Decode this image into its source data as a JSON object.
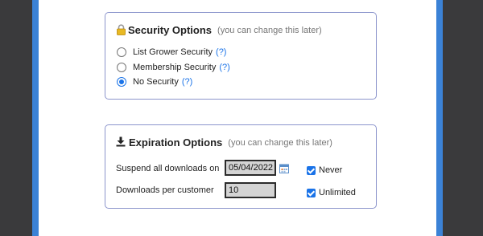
{
  "security": {
    "title": "Security Options",
    "note": "(you can change this later)",
    "options": [
      {
        "label": "List Grower Security",
        "help": "(?)",
        "selected": false
      },
      {
        "label": "Membership Security",
        "help": "(?)",
        "selected": false
      },
      {
        "label": "No Security",
        "help": "(?)",
        "selected": true
      }
    ]
  },
  "expiration": {
    "title": "Expiration Options",
    "note": "(you can change this later)",
    "suspend_label": "Suspend all downloads on",
    "suspend_date": "05/04/2022",
    "never_label": "Never",
    "never_checked": true,
    "per_customer_label": "Downloads per customer",
    "per_customer_value": "10",
    "unlimited_label": "Unlimited",
    "unlimited_checked": true
  },
  "colors": {
    "accent": "#1a73e8",
    "section_border": "#8c95cc",
    "frame": "#3b82d6"
  }
}
